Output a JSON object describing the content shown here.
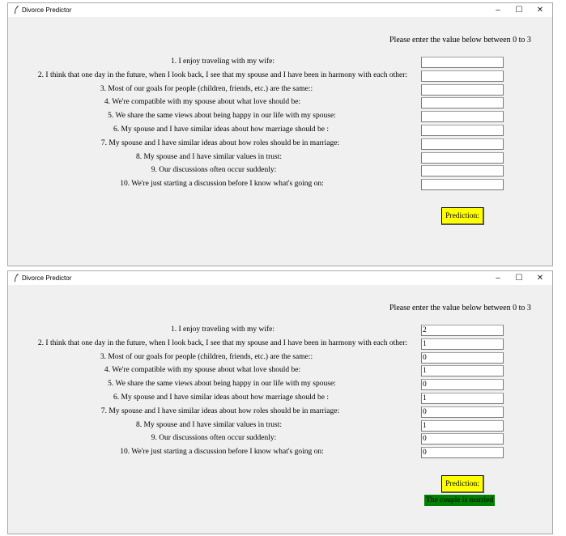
{
  "window_title": "Divorce Predictor",
  "controls": {
    "minimize": "–",
    "maximize": "☐",
    "close": "✕"
  },
  "instruction": "Please enter the value below between 0 to 3",
  "questions": [
    "1. I enjoy traveling with my wife:",
    "2. I think that one day in the future, when I look back, I see that my spouse and I have been in harmony with each other:",
    "3. Most of our goals for people (children, friends, etc.) are the same::",
    "4. We're compatible with my spouse about what love should be:",
    "5. We share the same views about being happy in our life with my spouse:",
    "6. My spouse and I have similar ideas about how marriage should be :",
    "7. My spouse and I have similar ideas about how roles should be in marriage:",
    "8. My spouse and I have similar values in trust:",
    "9. Our discussions often occur suddenly:",
    "10. We're just starting a discussion before I know what's going on:"
  ],
  "windows": [
    {
      "answers": [
        "",
        "",
        "",
        "",
        "",
        "",
        "",
        "",
        "",
        ""
      ],
      "result": ""
    },
    {
      "answers": [
        "2",
        "1",
        "0",
        "1",
        "0",
        "1",
        "0",
        "1",
        "0",
        "0"
      ],
      "result": "The couple is married"
    }
  ],
  "prediction_button": "Prediction:",
  "colors": {
    "button": "#ffff00",
    "result_bg": "#008000",
    "window_bg": "#f0f0f0"
  }
}
